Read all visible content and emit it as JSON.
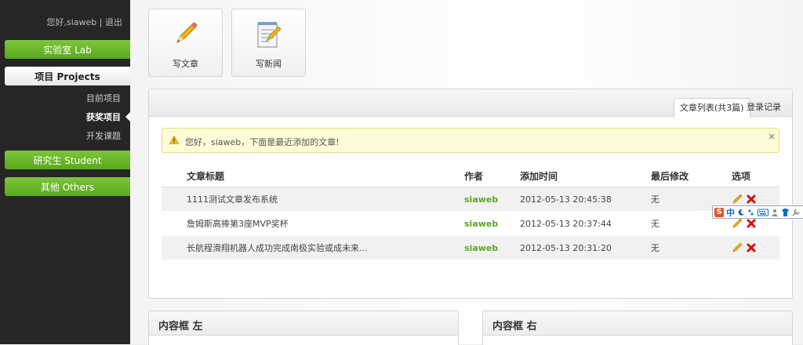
{
  "sidebar": {
    "user_text": "您好,siaweb | 退出",
    "nav": [
      {
        "label": "实验室 Lab"
      },
      {
        "label": "项目 Projects"
      },
      {
        "label": "研究生 Student"
      },
      {
        "label": "其他 Others"
      }
    ],
    "sub": [
      "目前项目",
      "获奖项目",
      "开发课题"
    ]
  },
  "quick": {
    "write_article": "写文章",
    "write_news": "写新闻"
  },
  "panel": {
    "tabs": [
      "文章列表(共3篇)",
      "登录记录"
    ],
    "alert": "您好，siaweb，下面是最近添加的文章!",
    "alert_close": "×",
    "headers": [
      "文章标题",
      "作者",
      "添加时间",
      "最后修改",
      "选项"
    ],
    "rows": [
      {
        "title": "1111测试文章发布系统",
        "author": "siaweb",
        "added": "2012-05-13 20:45:38",
        "modified": "无"
      },
      {
        "title": "詹姆斯高捧第3座MVP奖杯",
        "author": "siaweb",
        "added": "2012-05-13 20:37:44",
        "modified": "无"
      },
      {
        "title": "长航程滑翔机器人成功完成南极实验或成未来...",
        "author": "siaweb",
        "added": "2012-05-13 20:31:20",
        "modified": "无"
      }
    ]
  },
  "ime": {
    "s": "S",
    "zh": "中"
  },
  "boxes": {
    "left": "内容框 左",
    "right": "内容框 右"
  },
  "colors": {
    "accent_green": "#5aa81e",
    "sidebar_bg": "#262626",
    "alert_bg": "#fefbd8"
  }
}
